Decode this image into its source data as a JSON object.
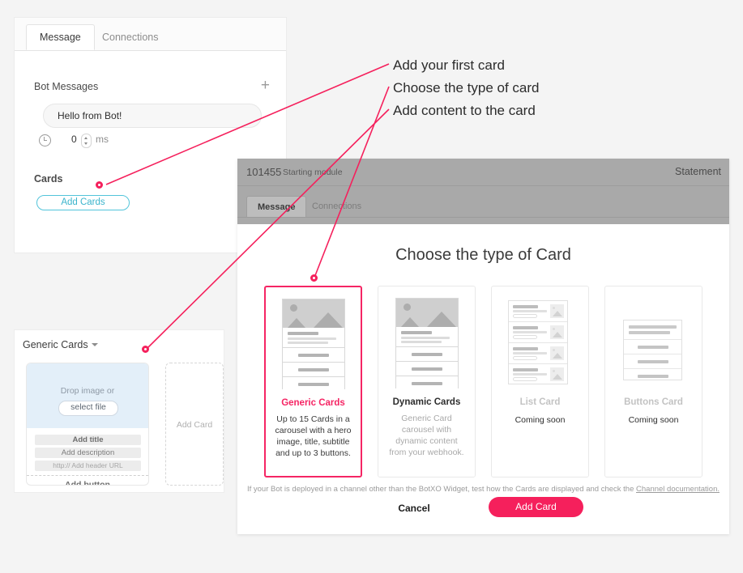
{
  "annotations": [
    {
      "text": "Add your first card"
    },
    {
      "text": "Choose the type of card"
    },
    {
      "text": "Add content to the card"
    }
  ],
  "back_panel": {
    "tabs": [
      {
        "label": "Message",
        "active": true
      },
      {
        "label": "Connections",
        "active": false
      }
    ],
    "bot_messages_label": "Bot Messages",
    "add_icon": "plus-icon",
    "message_value": "Hello from Bot!",
    "delay": {
      "icon": "clock-icon",
      "value": "0",
      "unit": "ms"
    },
    "cards_label": "Cards",
    "add_cards_button": "Add Cards"
  },
  "editor_panel": {
    "title": "Generic Cards",
    "caret_icon": "chevron-down-icon",
    "drop_text": "Drop image or",
    "select_file_button": "select file",
    "fields": [
      {
        "label": "Add title"
      },
      {
        "label": "Add description"
      },
      {
        "label": "http:// Add header URL"
      }
    ],
    "add_button_label": "Add button",
    "add_card_placeholder": "Add Card"
  },
  "modal": {
    "header": {
      "id": "101455",
      "subtitle": "Starting module",
      "right_label": "Statement",
      "tabs": [
        {
          "label": "Message",
          "active": true
        },
        {
          "label": "Connections",
          "active": false
        }
      ]
    },
    "title": "Choose the type of Card",
    "options": [
      {
        "name": "Generic Cards",
        "description": "Up to 15 Cards in a carousel with a hero image, title, subtitle and up to 3 buttons.",
        "selected": true,
        "disabled": false,
        "thumb": "hero-card"
      },
      {
        "name": "Dynamic Cards",
        "description": "Generic Card carousel with dynamic content from your webhook.",
        "selected": false,
        "disabled": false,
        "thumb": "hero-card"
      },
      {
        "name": "List Card",
        "description": "Coming soon",
        "selected": false,
        "disabled": true,
        "thumb": "list-card"
      },
      {
        "name": "Buttons Card",
        "description": "Coming soon",
        "selected": false,
        "disabled": true,
        "thumb": "buttons-card"
      }
    ],
    "note_text": "If your Bot is deployed in a channel other than the BotXO Widget, test how the Cards are displayed and check the ",
    "note_link": "Channel documentation.",
    "cancel_button": "Cancel",
    "add_card_button": "Add Card"
  },
  "colors": {
    "accent_pink": "#f5205c",
    "accent_cyan": "#3bb4cc",
    "page_background": "#f4f4f4",
    "modal_header": "#a9a9a9"
  }
}
